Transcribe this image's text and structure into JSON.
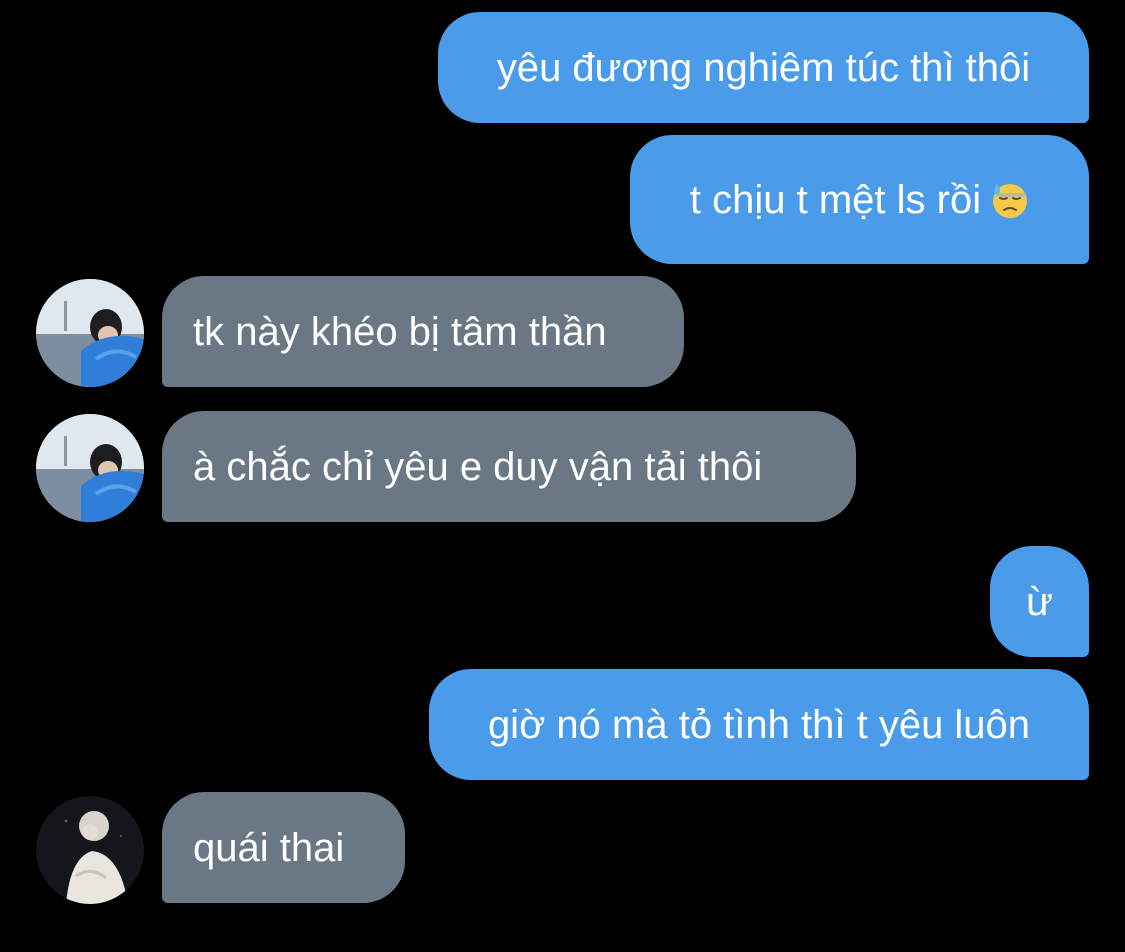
{
  "chat": {
    "messages": [
      {
        "direction": "sent",
        "text": "yêu đương nghiêm túc thì thôi"
      },
      {
        "direction": "sent",
        "text": "t chịu t mệt ls rồi",
        "emoji": "downcast-face-with-sweat-icon"
      },
      {
        "direction": "received",
        "sender": "contact-1",
        "text": "tk này khéo bị tâm thần"
      },
      {
        "direction": "received",
        "sender": "contact-1",
        "text": "à chắc chỉ yêu e duy vận tải thôi"
      },
      {
        "direction": "sent",
        "text": "ừ"
      },
      {
        "direction": "sent",
        "text": "giờ nó mà tỏ tình thì t yêu luôn"
      },
      {
        "direction": "received",
        "sender": "contact-2",
        "text": "quái thai"
      }
    ]
  },
  "colors": {
    "background": "#000000",
    "sent_bubble": "#4a9be9",
    "received_bubble": "#6a7785",
    "text": "#ffffff"
  }
}
